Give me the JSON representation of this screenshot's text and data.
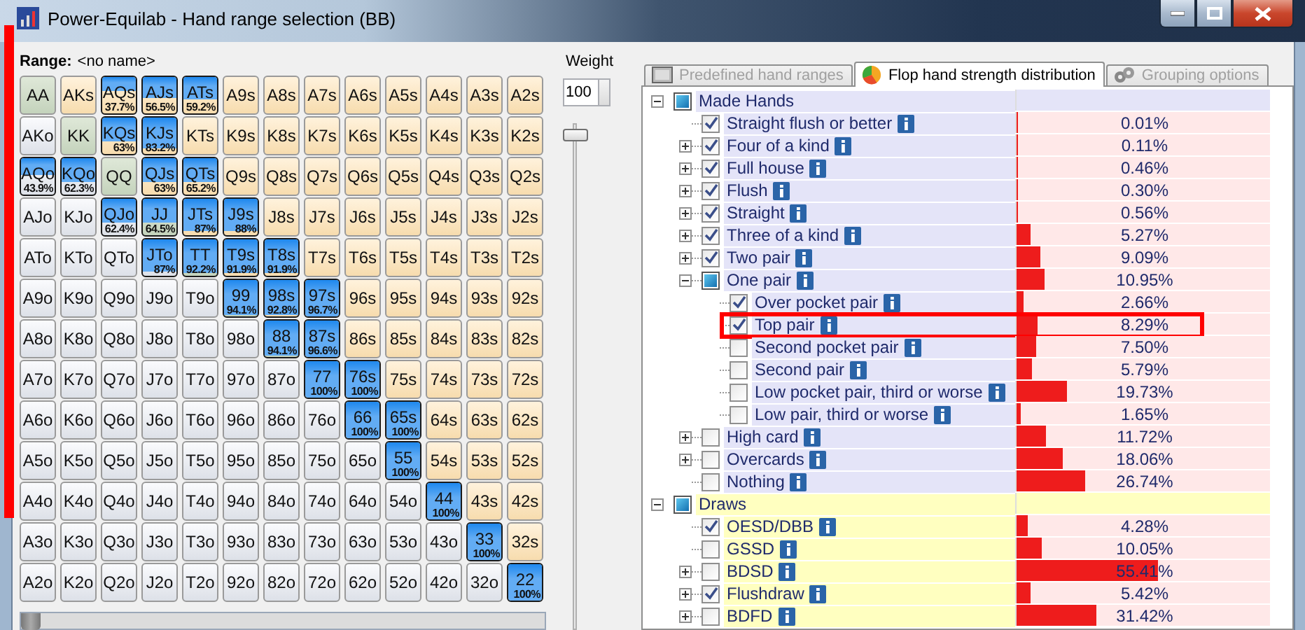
{
  "window": {
    "title": "Power-Equilab - Hand range selection (BB)"
  },
  "range": {
    "label": "Range:",
    "name": "<no name>"
  },
  "hand_grid": {
    "rows": [
      [
        {
          "label": "AA"
        },
        {
          "label": "AKs"
        },
        {
          "label": "AQs",
          "level": 0.377,
          "percent": "37.7%"
        },
        {
          "label": "AJs",
          "level": 0.565,
          "percent": "56.5%"
        },
        {
          "label": "ATs",
          "level": 0.592,
          "percent": "59.2%"
        },
        {
          "label": "A9s"
        },
        {
          "label": "A8s"
        },
        {
          "label": "A7s"
        },
        {
          "label": "A6s"
        },
        {
          "label": "A5s"
        },
        {
          "label": "A4s"
        },
        {
          "label": "A3s"
        },
        {
          "label": "A2s"
        }
      ],
      [
        {
          "label": "AKo"
        },
        {
          "label": "KK"
        },
        {
          "label": "KQs",
          "level": 0.63,
          "percent": "63%"
        },
        {
          "label": "KJs",
          "level": 0.832,
          "percent": "83.2%"
        },
        {
          "label": "KTs"
        },
        {
          "label": "K9s"
        },
        {
          "label": "K8s"
        },
        {
          "label": "K7s"
        },
        {
          "label": "K6s"
        },
        {
          "label": "K5s"
        },
        {
          "label": "K4s"
        },
        {
          "label": "K3s"
        },
        {
          "label": "K2s"
        }
      ],
      [
        {
          "label": "AQo",
          "level": 0.439,
          "percent": "43.9%"
        },
        {
          "label": "KQo",
          "level": 0.623,
          "percent": "62.3%"
        },
        {
          "label": "QQ"
        },
        {
          "label": "QJs",
          "level": 0.63,
          "percent": "63%"
        },
        {
          "label": "QTs",
          "level": 0.652,
          "percent": "65.2%"
        },
        {
          "label": "Q9s"
        },
        {
          "label": "Q8s"
        },
        {
          "label": "Q7s"
        },
        {
          "label": "Q6s"
        },
        {
          "label": "Q5s"
        },
        {
          "label": "Q4s"
        },
        {
          "label": "Q3s"
        },
        {
          "label": "Q2s"
        }
      ],
      [
        {
          "label": "AJo"
        },
        {
          "label": "KJo"
        },
        {
          "label": "QJo",
          "level": 0.624,
          "percent": "62.4%"
        },
        {
          "label": "JJ",
          "level": 0.645,
          "percent": "64.5%"
        },
        {
          "label": "JTs",
          "level": 0.87,
          "percent": "87%"
        },
        {
          "label": "J9s",
          "level": 0.88,
          "percent": "88%"
        },
        {
          "label": "J8s"
        },
        {
          "label": "J7s"
        },
        {
          "label": "J6s"
        },
        {
          "label": "J5s"
        },
        {
          "label": "J4s"
        },
        {
          "label": "J3s"
        },
        {
          "label": "J2s"
        }
      ],
      [
        {
          "label": "ATo"
        },
        {
          "label": "KTo"
        },
        {
          "label": "QTo"
        },
        {
          "label": "JTo",
          "level": 0.87,
          "percent": "87%"
        },
        {
          "label": "TT",
          "level": 0.922,
          "percent": "92.2%"
        },
        {
          "label": "T9s",
          "level": 0.919,
          "percent": "91.9%"
        },
        {
          "label": "T8s",
          "level": 0.919,
          "percent": "91.9%"
        },
        {
          "label": "T7s"
        },
        {
          "label": "T6s"
        },
        {
          "label": "T5s"
        },
        {
          "label": "T4s"
        },
        {
          "label": "T3s"
        },
        {
          "label": "T2s"
        }
      ],
      [
        {
          "label": "A9o"
        },
        {
          "label": "K9o"
        },
        {
          "label": "Q9o"
        },
        {
          "label": "J9o"
        },
        {
          "label": "T9o"
        },
        {
          "label": "99",
          "level": 0.941,
          "percent": "94.1%"
        },
        {
          "label": "98s",
          "level": 0.928,
          "percent": "92.8%"
        },
        {
          "label": "97s",
          "level": 0.967,
          "percent": "96.7%"
        },
        {
          "label": "96s"
        },
        {
          "label": "95s"
        },
        {
          "label": "94s"
        },
        {
          "label": "93s"
        },
        {
          "label": "92s"
        }
      ],
      [
        {
          "label": "A8o"
        },
        {
          "label": "K8o"
        },
        {
          "label": "Q8o"
        },
        {
          "label": "J8o"
        },
        {
          "label": "T8o"
        },
        {
          "label": "98o"
        },
        {
          "label": "88",
          "level": 0.941,
          "percent": "94.1%"
        },
        {
          "label": "87s",
          "level": 0.966,
          "percent": "96.6%"
        },
        {
          "label": "86s"
        },
        {
          "label": "85s"
        },
        {
          "label": "84s"
        },
        {
          "label": "83s"
        },
        {
          "label": "82s"
        }
      ],
      [
        {
          "label": "A7o"
        },
        {
          "label": "K7o"
        },
        {
          "label": "Q7o"
        },
        {
          "label": "J7o"
        },
        {
          "label": "T7o"
        },
        {
          "label": "97o"
        },
        {
          "label": "87o"
        },
        {
          "label": "77",
          "level": 1,
          "percent": "100%"
        },
        {
          "label": "76s",
          "level": 1,
          "percent": "100%"
        },
        {
          "label": "75s"
        },
        {
          "label": "74s"
        },
        {
          "label": "73s"
        },
        {
          "label": "72s"
        }
      ],
      [
        {
          "label": "A6o"
        },
        {
          "label": "K6o"
        },
        {
          "label": "Q6o"
        },
        {
          "label": "J6o"
        },
        {
          "label": "T6o"
        },
        {
          "label": "96o"
        },
        {
          "label": "86o"
        },
        {
          "label": "76o"
        },
        {
          "label": "66",
          "level": 1,
          "percent": "100%"
        },
        {
          "label": "65s",
          "level": 1,
          "percent": "100%"
        },
        {
          "label": "64s"
        },
        {
          "label": "63s"
        },
        {
          "label": "62s"
        }
      ],
      [
        {
          "label": "A5o"
        },
        {
          "label": "K5o"
        },
        {
          "label": "Q5o"
        },
        {
          "label": "J5o"
        },
        {
          "label": "T5o"
        },
        {
          "label": "95o"
        },
        {
          "label": "85o"
        },
        {
          "label": "75o"
        },
        {
          "label": "65o"
        },
        {
          "label": "55",
          "level": 1,
          "percent": "100%"
        },
        {
          "label": "54s"
        },
        {
          "label": "53s"
        },
        {
          "label": "52s"
        }
      ],
      [
        {
          "label": "A4o"
        },
        {
          "label": "K4o"
        },
        {
          "label": "Q4o"
        },
        {
          "label": "J4o"
        },
        {
          "label": "T4o"
        },
        {
          "label": "94o"
        },
        {
          "label": "84o"
        },
        {
          "label": "74o"
        },
        {
          "label": "64o"
        },
        {
          "label": "54o"
        },
        {
          "label": "44",
          "level": 1,
          "percent": "100%"
        },
        {
          "label": "43s"
        },
        {
          "label": "42s"
        }
      ],
      [
        {
          "label": "A3o"
        },
        {
          "label": "K3o"
        },
        {
          "label": "Q3o"
        },
        {
          "label": "J3o"
        },
        {
          "label": "T3o"
        },
        {
          "label": "93o"
        },
        {
          "label": "83o"
        },
        {
          "label": "73o"
        },
        {
          "label": "63o"
        },
        {
          "label": "53o"
        },
        {
          "label": "43o"
        },
        {
          "label": "33",
          "level": 1,
          "percent": "100%"
        },
        {
          "label": "32s"
        }
      ],
      [
        {
          "label": "A2o"
        },
        {
          "label": "K2o"
        },
        {
          "label": "Q2o"
        },
        {
          "label": "J2o"
        },
        {
          "label": "T2o"
        },
        {
          "label": "92o"
        },
        {
          "label": "82o"
        },
        {
          "label": "72o"
        },
        {
          "label": "62o"
        },
        {
          "label": "52o"
        },
        {
          "label": "42o"
        },
        {
          "label": "32o"
        },
        {
          "label": "22",
          "level": 1,
          "percent": "100%"
        }
      ]
    ]
  },
  "grid_slider": {
    "level": 0
  },
  "weight": {
    "label": "Weight",
    "value": "100",
    "level": 1
  },
  "tabs": [
    {
      "label": "Predefined hand ranges",
      "selected": false
    },
    {
      "label": "Flop hand strength distribution",
      "selected": true
    },
    {
      "label": "Grouping options",
      "selected": false
    }
  ],
  "tree": [
    {
      "label": "Made Hands",
      "color": "#e4e4f8",
      "partial": true,
      "expanded": true,
      "children": [
        {
          "label": "Straight flush or better",
          "checked": true,
          "value": "0.01%",
          "level": 0.0001
        },
        {
          "label": "Four of a kind",
          "checked": true,
          "expanded": false,
          "value": "0.11%",
          "level": 0.0011
        },
        {
          "label": "Full house",
          "checked": true,
          "expanded": false,
          "value": "0.46%",
          "level": 0.0046
        },
        {
          "label": "Flush",
          "checked": true,
          "expanded": false,
          "value": "0.30%",
          "level": 0.003
        },
        {
          "label": "Straight",
          "checked": true,
          "expanded": false,
          "value": "0.56%",
          "level": 0.0056
        },
        {
          "label": "Three of a kind",
          "checked": true,
          "expanded": false,
          "value": "5.27%",
          "level": 0.0527
        },
        {
          "label": "Two pair",
          "checked": true,
          "expanded": false,
          "value": "9.09%",
          "level": 0.0909
        },
        {
          "label": "One pair",
          "checked": false,
          "partial": true,
          "expanded": true,
          "value": "10.95%",
          "level": 0.1095,
          "children": [
            {
              "label": "Over pocket pair",
              "checked": true,
              "value": "2.66%",
              "level": 0.0266,
              "highlighted": false
            },
            {
              "label": "Top pair",
              "checked": true,
              "value": "8.29%",
              "level": 0.0829,
              "highlighted": true
            },
            {
              "label": "Second pocket pair",
              "checked": false,
              "value": "7.50%",
              "level": 0.075,
              "highlighted": false
            },
            {
              "label": "Second pair",
              "checked": false,
              "value": "5.79%",
              "level": 0.0579,
              "highlighted": false
            },
            {
              "label": "Low pocket pair, third or worse",
              "checked": false,
              "value": "19.73%",
              "level": 0.1973,
              "highlighted": false
            },
            {
              "label": "Low pair, third or worse",
              "checked": false,
              "value": "1.65%",
              "level": 0.0165,
              "highlighted": false
            }
          ]
        },
        {
          "label": "High card",
          "checked": false,
          "expanded": false,
          "value": "11.72%",
          "level": 0.1172
        },
        {
          "label": "Overcards",
          "checked": false,
          "expanded": false,
          "value": "18.06%",
          "level": 0.1806
        },
        {
          "label": "Nothing",
          "checked": false,
          "value": "26.74%",
          "level": 0.2674
        }
      ]
    },
    {
      "label": "Draws",
      "color": "#ffffc0",
      "partial": true,
      "expanded": true,
      "children": [
        {
          "label": "OESD/DBB",
          "checked": true,
          "value": "4.28%",
          "level": 0.0428
        },
        {
          "label": "GSSD",
          "checked": false,
          "value": "10.05%",
          "level": 0.1005
        },
        {
          "label": "BDSD",
          "checked": false,
          "expanded": false,
          "value": "55.41%",
          "level": 0.5541
        },
        {
          "label": "Flushdraw",
          "checked": true,
          "expanded": false,
          "value": "5.42%",
          "level": 0.0542
        },
        {
          "label": "BDFD",
          "checked": false,
          "expanded": false,
          "value": "31.42%",
          "level": 0.3142
        }
      ]
    }
  ]
}
